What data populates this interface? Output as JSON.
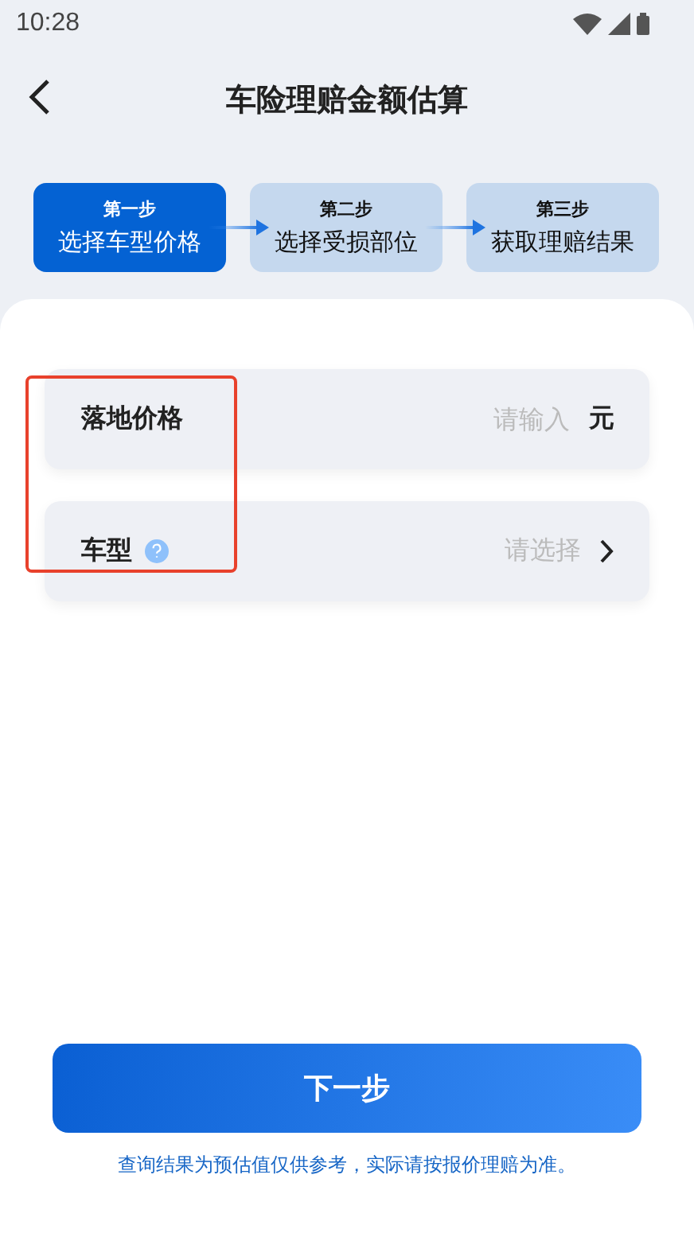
{
  "status_bar": {
    "time": "10:28"
  },
  "header": {
    "title": "车险理赔金额估算"
  },
  "steps": [
    {
      "step": "第一步",
      "label": "选择车型价格",
      "selected": true
    },
    {
      "step": "第二步",
      "label": "选择受损部位",
      "selected": false
    },
    {
      "step": "第三步",
      "label": "获取理赔结果",
      "selected": false
    }
  ],
  "fields": [
    {
      "kind": "input",
      "label": "落地价格",
      "placeholder": "请输入",
      "unit": "元",
      "help": false
    },
    {
      "kind": "select",
      "label": "车型",
      "placeholder": "请选择",
      "help": true
    }
  ],
  "next_button": "下一步",
  "note": "查询结果为预估值仅供参考，实际请按报价理赔为准。"
}
